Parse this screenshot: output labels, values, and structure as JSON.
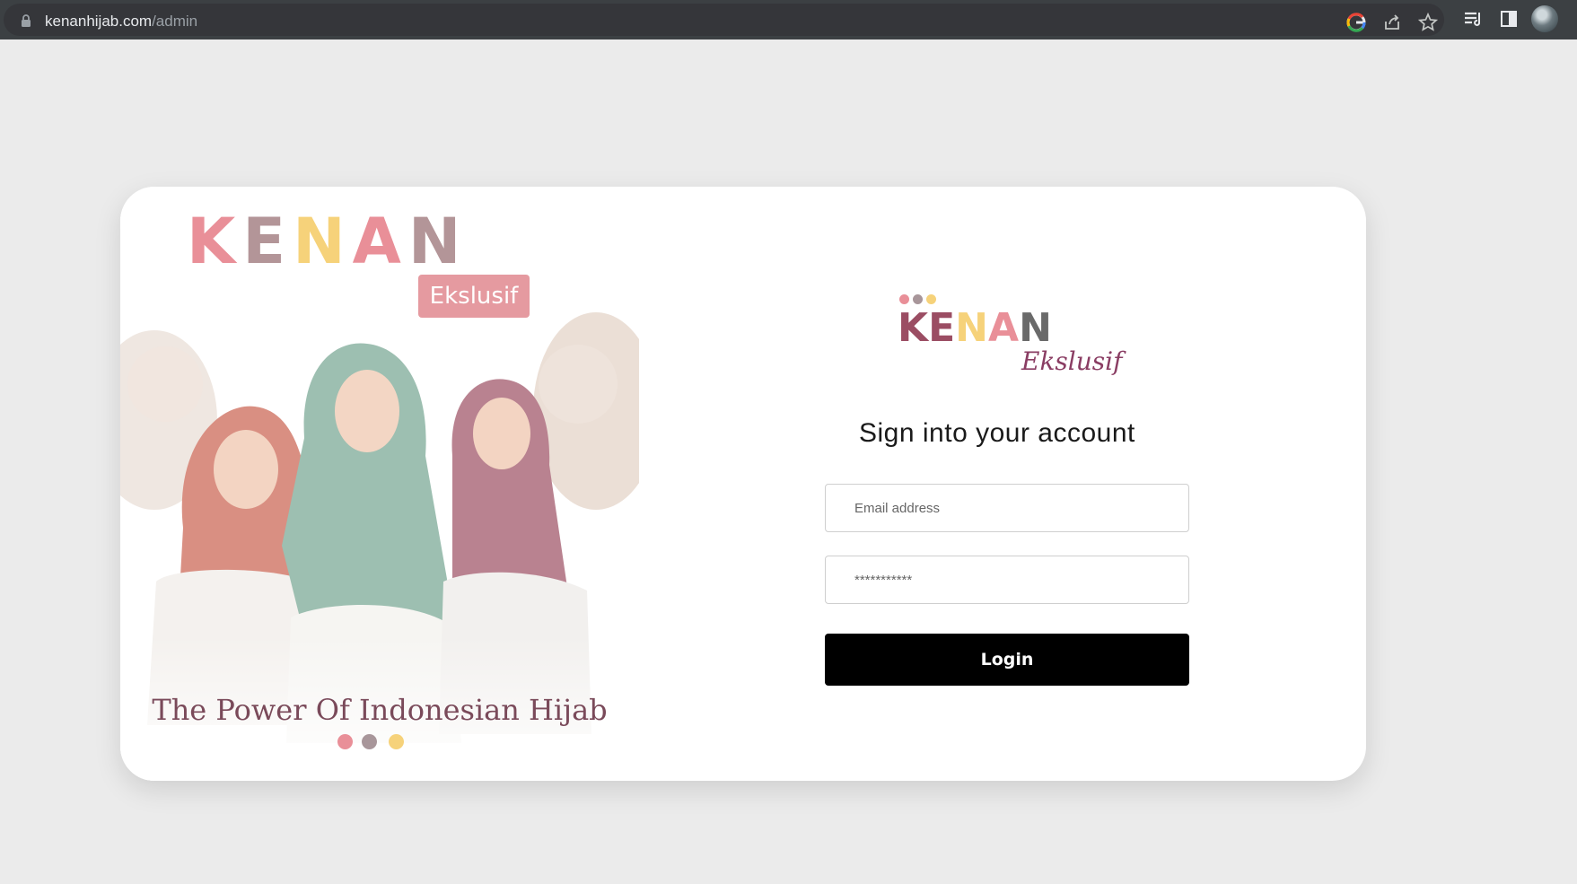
{
  "browser": {
    "url_host": "kenanhijab.com",
    "url_path": "/admin",
    "icons": [
      "lock-icon",
      "google-icon",
      "share-icon",
      "star-icon",
      "reading-list-icon",
      "side-panel-icon",
      "avatar"
    ]
  },
  "promo": {
    "brand_letters": [
      {
        "char": "K",
        "color": "#e98f98"
      },
      {
        "char": "E",
        "color": "#b39598"
      },
      {
        "char": "N",
        "color": "#f6d27a"
      },
      {
        "char": "A",
        "color": "#e98f98"
      },
      {
        "char": "N",
        "color": "#b39598"
      }
    ],
    "badge": "Ekslusif",
    "tagline": "The Power Of Indonesian Hijab",
    "dot_colors": [
      "#e98f98",
      "#a8969a",
      "#f6d27a"
    ]
  },
  "login": {
    "logo_letters": [
      {
        "char": "K",
        "color": "#9b4d63"
      },
      {
        "char": "E",
        "color": "#9b4d63"
      },
      {
        "char": "N",
        "color": "#f6d27a"
      },
      {
        "char": "A",
        "color": "#e98f98"
      },
      {
        "char": "N",
        "color": "#6a6a6a"
      }
    ],
    "logo_script": "Ekslusif",
    "logo_dot_colors": [
      "#e98f98",
      "#a8969a",
      "#f6d27a"
    ],
    "heading": "Sign into your account",
    "email_placeholder": "Email address",
    "password_placeholder": "***********",
    "button_label": "Login"
  }
}
